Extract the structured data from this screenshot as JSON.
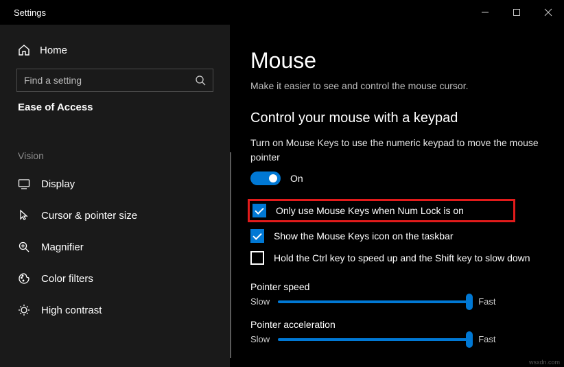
{
  "window": {
    "title": "Settings"
  },
  "sidebar": {
    "home": "Home",
    "search_placeholder": "Find a setting",
    "section": "Ease of Access",
    "group": "Vision",
    "items": [
      {
        "label": "Display"
      },
      {
        "label": "Cursor & pointer size"
      },
      {
        "label": "Magnifier"
      },
      {
        "label": "Color filters"
      },
      {
        "label": "High contrast"
      }
    ]
  },
  "main": {
    "title": "Mouse",
    "subtitle": "Make it easier to see and control the mouse cursor.",
    "section_title": "Control your mouse with a keypad",
    "desc": "Turn on Mouse Keys to use the numeric keypad to move the mouse pointer",
    "toggle_state": "On",
    "checks": [
      {
        "label": "Only use Mouse Keys when Num Lock is on",
        "checked": true,
        "highlight": true
      },
      {
        "label": "Show the Mouse Keys icon on the taskbar",
        "checked": true,
        "highlight": false
      },
      {
        "label": "Hold the Ctrl key to speed up and the Shift key to slow down",
        "checked": false,
        "highlight": false
      }
    ],
    "sliders": [
      {
        "label": "Pointer speed",
        "min": "Slow",
        "max": "Fast",
        "value": 100
      },
      {
        "label": "Pointer acceleration",
        "min": "Slow",
        "max": "Fast",
        "value": 100
      }
    ]
  },
  "watermark": "wsxdn.com"
}
